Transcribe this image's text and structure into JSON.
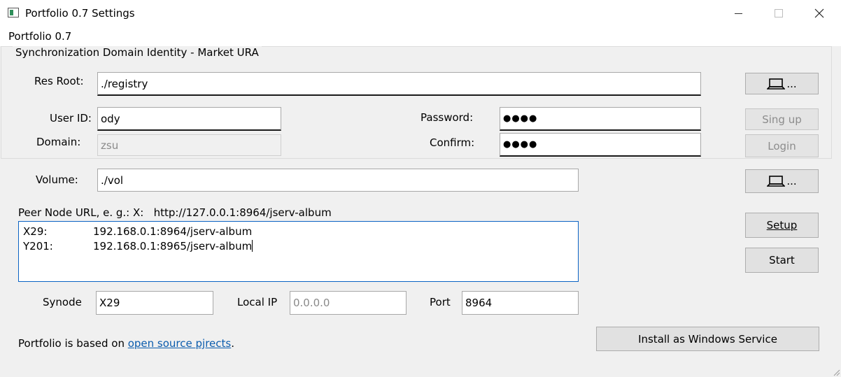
{
  "window": {
    "title": "Portfolio 0.7 Settings",
    "menu_label": "Portfolio 0.7"
  },
  "group": {
    "title": "Synchronization Domain Identity - Market URA",
    "res_root_label": "Res Root:",
    "res_root_value": "./registry",
    "user_id_label": "User ID:",
    "user_id_value": "ody",
    "domain_label": "Domain:",
    "domain_value": "zsu",
    "password_label": "Password:",
    "password_value": "●●●●",
    "confirm_label": "Confirm:",
    "confirm_value": "●●●●",
    "browse_label": "...",
    "signup_label": "Sing up",
    "login_label": "Login"
  },
  "volume": {
    "label": "Volume:",
    "value": "./vol",
    "browse_label": "..."
  },
  "peers": {
    "label": "Peer Node URL, e. g.: X:   http://127.0.0.1:8964/jserv-album",
    "rows": [
      {
        "name": "X29:",
        "url": "192.168.0.1:8964/jserv-album"
      },
      {
        "name": "Y201:",
        "url": "192.168.0.1:8965/jserv-album"
      }
    ]
  },
  "node": {
    "synode_label": "Synode",
    "synode_value": "X29",
    "localip_label": "Local IP",
    "localip_placeholder": "0.0.0.0",
    "port_label": "Port",
    "port_value": "8964"
  },
  "actions": {
    "setup_label": "Setup",
    "start_label": "Start",
    "install_label": "Install as Windows Service"
  },
  "footer": {
    "prefix": "Portfolio is based on ",
    "link": "open source pjrects",
    "suffix": "."
  },
  "icons": {
    "app": "app-window-icon",
    "browse": "laptop-icon"
  },
  "colors": {
    "link": "#0b5cad",
    "focus_border": "#0b63c4",
    "background": "#f0f0f0"
  }
}
